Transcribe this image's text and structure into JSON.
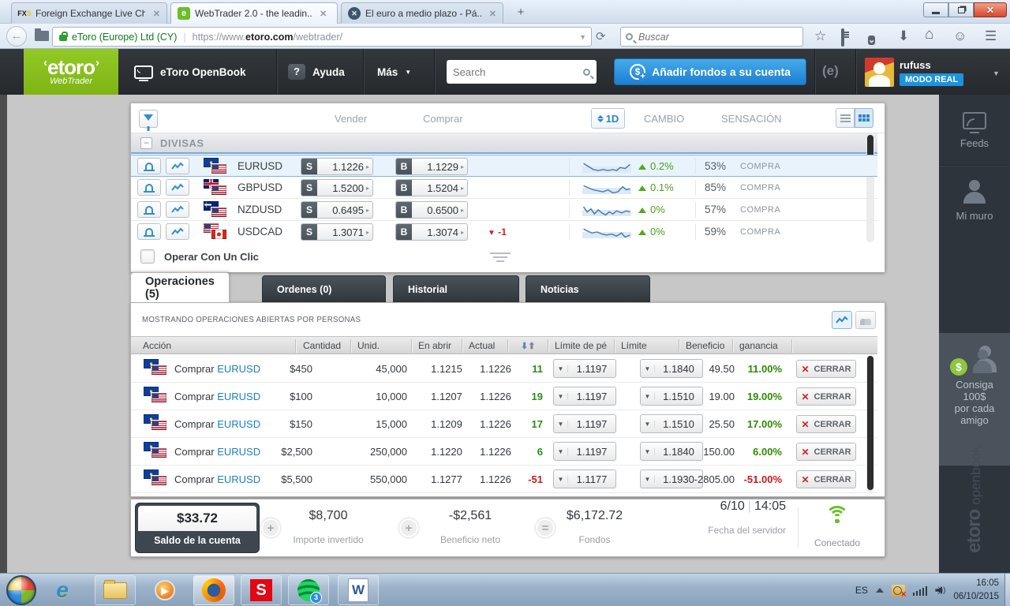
{
  "browser": {
    "tabs": [
      {
        "title": "Foreign Exchange Live Cha...",
        "close": "✕"
      },
      {
        "title": "WebTrader 2.0 - the leadin...",
        "close": "✕"
      },
      {
        "title": "El euro a medio plazo - Pá...",
        "close": "✕"
      }
    ],
    "security_label": "eToro (Europe) Ltd (CY)",
    "url_prefix": "https://www.",
    "url_domain": "etoro.com",
    "url_path": "/webtrader/",
    "search_placeholder": "Buscar"
  },
  "header": {
    "logo_text": "etoro",
    "logo_sub": "WebTrader",
    "openbook_label": "eToro OpenBook",
    "help_icon": "?",
    "help_label": "Ayuda",
    "more_label": "Más",
    "search_placeholder": "Search",
    "add_funds_label": "Añadir fondos a su cuenta",
    "dollar": "$",
    "username": "rufuss",
    "mode_badge": "MODO REAL"
  },
  "market": {
    "col_vender": "Vender",
    "col_comprar": "Comprar",
    "timeframe": "1D",
    "col_cambio": "CAMBIO",
    "col_sensacion": "SENSACIÓN",
    "group_collapse": "−",
    "group_title": "DIVISAS",
    "one_click_label": "Operar Con Un Clic",
    "rows": [
      {
        "symbol": "EURUSD",
        "sell_tag": "S",
        "sell": "1.1226",
        "buy_tag": "B",
        "buy": "1.1229",
        "arrow": "▸",
        "change": "0.2%",
        "sentiment": "53%",
        "sentiment_label": "COMPRA",
        "spark": "1,4 5,7 9,10 13,11 17,10 21,11 25,10 28,11 31,8 35,9 39,5"
      },
      {
        "symbol": "GBPUSD",
        "sell_tag": "S",
        "sell": "1.5200",
        "buy_tag": "B",
        "buy": "1.5204",
        "arrow": "▸",
        "change": "0.1%",
        "sentiment": "85%",
        "sentiment_label": "COMPRA",
        "spark": "1,5 5,7 9,9 13,10 17,11 21,9 25,12 29,11 33,6 36,9 39,8"
      },
      {
        "symbol": "NZDUSD",
        "sell_tag": "S",
        "sell": "0.6495",
        "buy_tag": "B",
        "buy": "0.6500",
        "arrow": "▸",
        "change": "0%",
        "sentiment": "57%",
        "sentiment_label": "COMPRA",
        "spark": "1,4 4,9 7,6 10,11 13,7 16,10 19,12 22,9 25,11 28,8 32,10 36,8 39,9"
      },
      {
        "symbol": "USDCAD",
        "sell_tag": "S",
        "sell": "1.3071",
        "buy_tag": "B",
        "buy": "1.3074",
        "arrow": "▸",
        "tick_arrow": "▼",
        "tick": "-1",
        "change": "0%",
        "sentiment": "59%",
        "sentiment_label": "COMPRA",
        "spark": "1,4 4,6 8,8 12,7 16,9 20,10 24,9 28,11 32,8 35,12 39,10"
      }
    ]
  },
  "tabs": [
    {
      "label": "Operaciones (5)"
    },
    {
      "label": "Ordenes (0)"
    },
    {
      "label": "Historial"
    },
    {
      "label": "Noticias"
    }
  ],
  "ops": {
    "showing_label": "MOSTRANDO OPERACIONES ABIERTAS POR PERSONAS",
    "close_label": "CERRAR",
    "close_x": "✕",
    "sort_down": "⬇",
    "sort_up": "⬆",
    "dd_arrow": "▼",
    "columns": {
      "accion": "Acción",
      "cantidad": "Cantidad",
      "unid": "Unid.",
      "en_abrir": "En abrir",
      "actual": "Actual",
      "limite_perdida": "Límite de pé",
      "limite": "Límite",
      "beneficio": "Beneficio",
      "ganancia": "ganancia"
    },
    "rows": [
      {
        "action": "Comprar",
        "symbol": "EURUSD",
        "amount": "$450",
        "units": "45,000",
        "open": "1.1215",
        "current": "1.1226",
        "pips": "11",
        "stop": "1.1197",
        "limit": "1.1840",
        "profit": "49.50",
        "gain": "11.00%"
      },
      {
        "action": "Comprar",
        "symbol": "EURUSD",
        "amount": "$100",
        "units": "10,000",
        "open": "1.1207",
        "current": "1.1226",
        "pips": "19",
        "stop": "1.1197",
        "limit": "1.1510",
        "profit": "19.00",
        "gain": "19.00%"
      },
      {
        "action": "Comprar",
        "symbol": "EURUSD",
        "amount": "$150",
        "units": "15,000",
        "open": "1.1209",
        "current": "1.1226",
        "pips": "17",
        "stop": "1.1197",
        "limit": "1.1510",
        "profit": "25.50",
        "gain": "17.00%"
      },
      {
        "action": "Comprar",
        "symbol": "EURUSD",
        "amount": "$2,500",
        "units": "250,000",
        "open": "1.1220",
        "current": "1.1226",
        "pips": "6",
        "stop": "1.1197",
        "limit": "1.1840",
        "profit": "150.00",
        "gain": "6.00%"
      },
      {
        "action": "Comprar",
        "symbol": "EURUSD",
        "amount": "$5,500",
        "units": "550,000",
        "open": "1.1277",
        "current": "1.1226",
        "pips": "-51",
        "stop": "1.1177",
        "limit": "1.1930",
        "profit": "-2805.00",
        "gain": "-51.00%"
      }
    ]
  },
  "status": {
    "balance": "$33.72",
    "balance_label": "Saldo de la cuenta",
    "plus": "+",
    "equals": "=",
    "invested": "$8,700",
    "invested_label": "Importe invertido",
    "net": "-$2,561",
    "net_label": "Beneficio neto",
    "funds": "$6,172.72",
    "funds_label": "Fondos",
    "server_date": "6/10",
    "server_time": "14:05",
    "server_label": "Fecha del servidor",
    "connected_label": "Conectado"
  },
  "sidebar": {
    "feeds_label": "Feeds",
    "wall_label": "Mi muro",
    "refer_badge": "$",
    "refer_lines": [
      "Consiga",
      "100$",
      "por cada",
      "amigo"
    ],
    "logo_main": "etoro",
    "logo_sub": "openbook"
  },
  "taskbar": {
    "lang": "ES",
    "spotify_badge": "3",
    "time": "16:05",
    "date": "06/10/2015"
  }
}
